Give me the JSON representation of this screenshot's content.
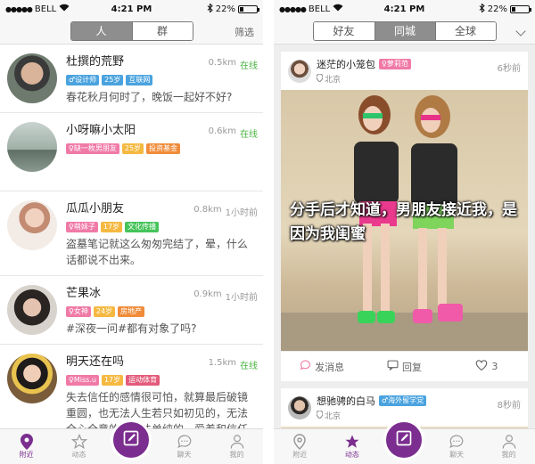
{
  "left": {
    "status": {
      "carrier": "BELL",
      "time": "4:21 PM",
      "battery": "22%",
      "battery_level": 0.22
    },
    "segments": [
      {
        "label": "人",
        "active": true
      },
      {
        "label": "群",
        "active": false
      }
    ],
    "filter_label": "筛选",
    "users": [
      {
        "name": "杜撰的荒野",
        "distance": "0.5km",
        "status": "在线",
        "online": true,
        "tags": [
          {
            "text": "♂设计师",
            "color": "#4aa3df"
          },
          {
            "text": "25岁",
            "color": "#4aa3df"
          },
          {
            "text": "互联网",
            "color": "#4aa3df"
          }
        ],
        "message": "春花秋月何时了，晚饭一起好不好?"
      },
      {
        "name": "小呀嘛小太阳",
        "distance": "0.6km",
        "status": "在线",
        "online": true,
        "tags": [
          {
            "text": "♀缺一枚男朋友",
            "color": "#f07aa6"
          },
          {
            "text": "25岁",
            "color": "#f5b942"
          },
          {
            "text": "投资基金",
            "color": "#f08c3a"
          }
        ],
        "message": ""
      },
      {
        "name": "瓜瓜小朋友",
        "distance": "0.8km",
        "status": "1小时前",
        "online": false,
        "tags": [
          {
            "text": "♀萌妹子",
            "color": "#f07aa6"
          },
          {
            "text": "17岁",
            "color": "#f5b942"
          },
          {
            "text": "文化传播",
            "color": "#45c45a"
          }
        ],
        "message": "盗墓笔记就这么匆匆完结了，晕，什么话都说不出来。"
      },
      {
        "name": "芒果冰",
        "distance": "0.9km",
        "status": "1小时前",
        "online": false,
        "tags": [
          {
            "text": "♀女神",
            "color": "#f07aa6"
          },
          {
            "text": "24岁",
            "color": "#f5b942"
          },
          {
            "text": "房地产",
            "color": "#f08c3a"
          }
        ],
        "message": "#深夜一问#都有对象了吗?"
      },
      {
        "name": "明天还在吗",
        "distance": "1.5km",
        "status": "在线",
        "online": true,
        "tags": [
          {
            "text": "♀Miss.u",
            "color": "#f07aa6"
          },
          {
            "text": "17岁",
            "color": "#f5b942"
          },
          {
            "text": "运动体育",
            "color": "#e35b7a"
          }
        ],
        "message": "失去信任的感情很可怕，就算最后破镜重圆，也无法人生若只如初见的，无法全心全意的，无法单纯的，爱着和信任着了。"
      }
    ],
    "tabs": [
      {
        "label": "附近",
        "icon": "location-pin-icon",
        "active": true
      },
      {
        "label": "动态",
        "icon": "star-icon",
        "active": false
      },
      {
        "label": "聊天",
        "icon": "chat-bubble-icon",
        "active": false
      },
      {
        "label": "我的",
        "icon": "person-icon",
        "active": false
      }
    ]
  },
  "right": {
    "status": {
      "carrier": "BELL",
      "time": "4:21 PM",
      "battery": "22%",
      "battery_level": 0.22
    },
    "segments": [
      {
        "label": "好友",
        "active": false
      },
      {
        "label": "同城",
        "active": true
      },
      {
        "label": "全球",
        "active": false
      }
    ],
    "posts": [
      {
        "name": "迷茫的小笼包",
        "tag": "♀萝莉范",
        "tag_color": "#f07aa6",
        "location": "北京",
        "time": "6秒前",
        "caption": "分手后才知道，男朋友接近我，是因为我闺蜜",
        "actions": {
          "message": "发消息",
          "reply": "回复",
          "likes": "3"
        }
      },
      {
        "name": "想驰骋的白马",
        "tag": "♂海外留学党",
        "tag_color": "#4aa3df",
        "location": "北京",
        "time": "8秒前"
      }
    ],
    "tabs": [
      {
        "label": "附近",
        "icon": "location-pin-icon",
        "active": false
      },
      {
        "label": "动态",
        "icon": "star-icon",
        "active": true
      },
      {
        "label": "聊天",
        "icon": "chat-bubble-icon",
        "active": false
      },
      {
        "label": "我的",
        "icon": "person-icon",
        "active": false
      }
    ]
  }
}
